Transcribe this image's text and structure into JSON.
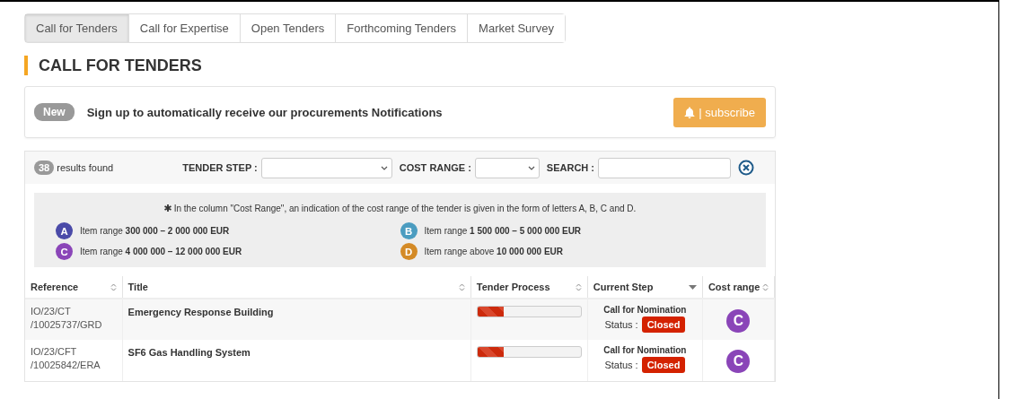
{
  "tabs": [
    {
      "label": "Call for Tenders",
      "selected": true
    },
    {
      "label": "Call for Expertise",
      "selected": false
    },
    {
      "label": "Open Tenders",
      "selected": false
    },
    {
      "label": "Forthcoming Tenders",
      "selected": false
    },
    {
      "label": "Market Survey",
      "selected": false
    }
  ],
  "heading": "CALL FOR TENDERS",
  "notification": {
    "badge": "New",
    "text": "Sign up to automatically receive our procurements Notifications",
    "button": "| subscribe"
  },
  "filters": {
    "count": "38",
    "count_label": "results found",
    "tender_step_label": "TENDER STEP :",
    "cost_range_label": "COST RANGE :",
    "search_label": "SEARCH :"
  },
  "legend": {
    "note": "In the column \"Cost Range\", an indication of the cost range of the tender is given in the form of letters A, B, C and D.",
    "items": [
      {
        "letter": "A",
        "color": "#4a4aa8",
        "text": "Item range **300 000 – 2 000 000 EUR**"
      },
      {
        "letter": "B",
        "color": "#4b9cc0",
        "text": "Item range **1 500 000 – 5 000 000 EUR**"
      },
      {
        "letter": "C",
        "color": "#8a45b8",
        "text": "Item range **4 000 000 – 12 000 000 EUR**"
      },
      {
        "letter": "D",
        "color": "#d48a26",
        "text": "Item range above **10 000 000 EUR**"
      }
    ]
  },
  "table": {
    "columns": [
      {
        "label": "Reference",
        "sorted": false
      },
      {
        "label": "Title",
        "sorted": false
      },
      {
        "label": "Tender Process",
        "sorted": false
      },
      {
        "label": "Current Step",
        "sorted": true
      },
      {
        "label": "Cost range",
        "sorted": false
      }
    ],
    "rows": [
      {
        "reference": [
          "IO/23/CT",
          "/10025737/GRD"
        ],
        "title": "Emergency Response Building",
        "level": 0.25,
        "step": "Call for Nomination",
        "status_label": "Status :",
        "status": "Closed",
        "cost": "C",
        "color": "#8a45b8"
      },
      {
        "reference": [
          "IO/23/CFT",
          "/10025842/ERA"
        ],
        "title": "SF6 Gas Handling System",
        "level": 0.25,
        "step": "Call for Nomination",
        "status_label": "Status :",
        "status": "Closed",
        "cost": "C",
        "color": "#8a45b8"
      }
    ]
  }
}
